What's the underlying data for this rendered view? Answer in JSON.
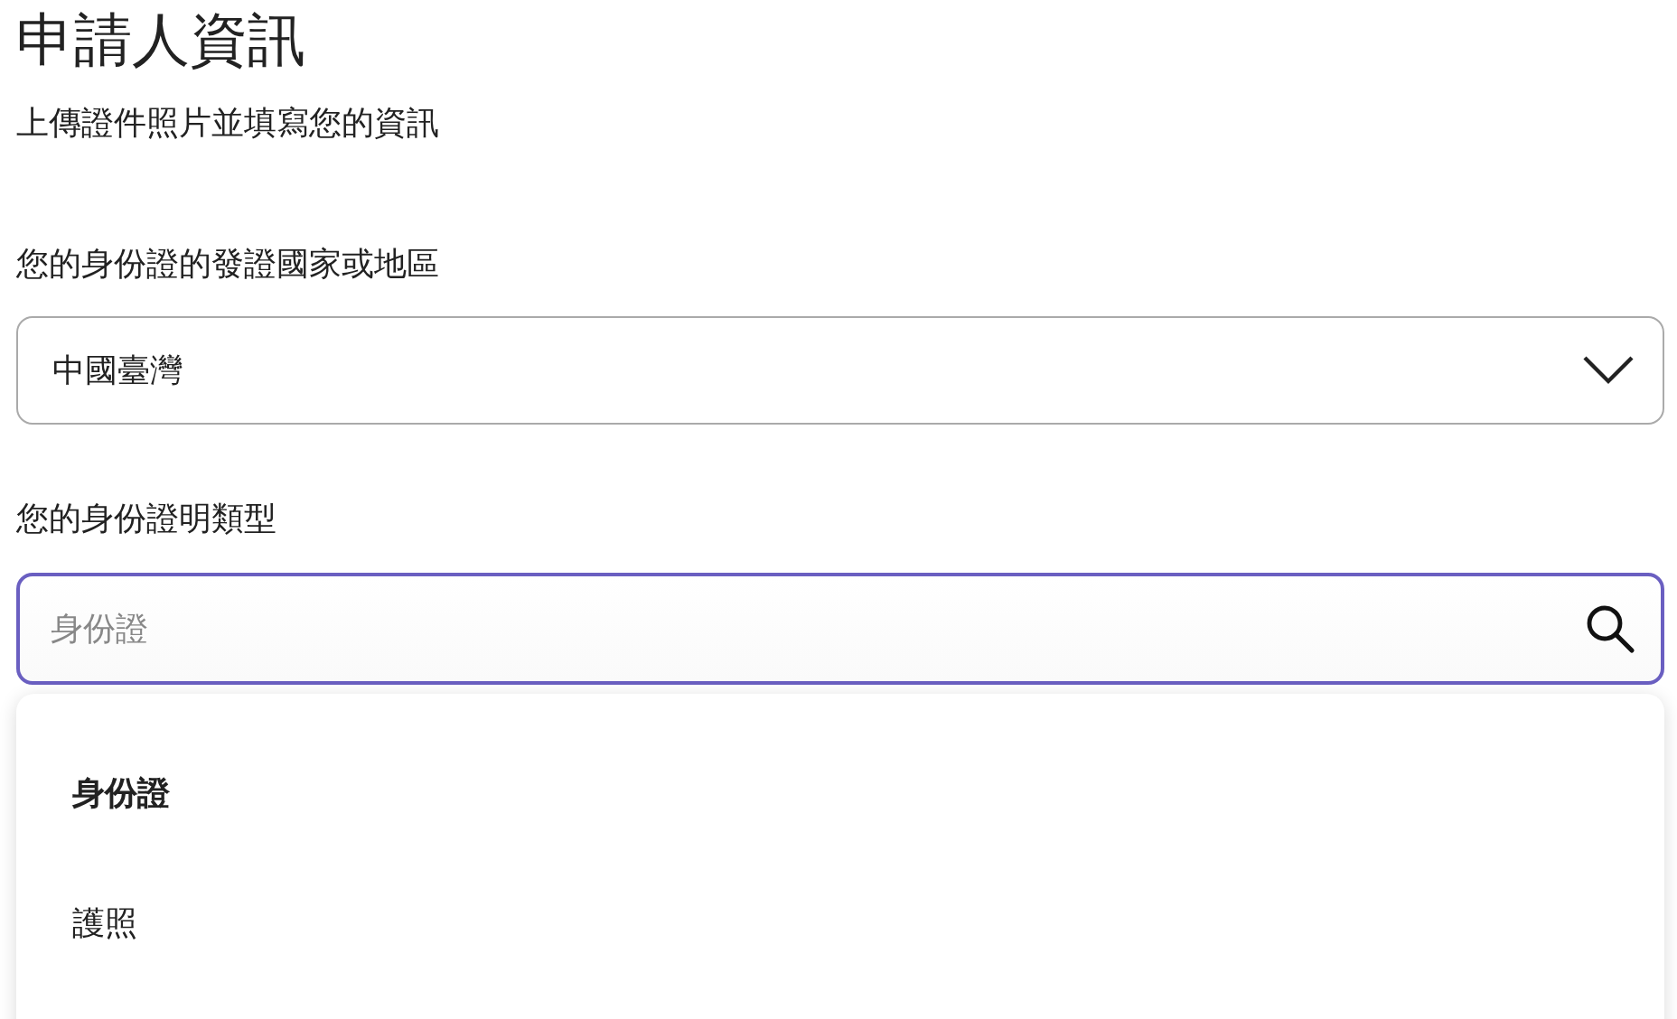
{
  "title": "申請人資訊",
  "subtitle": "上傳證件照片並填寫您的資訊",
  "country_field": {
    "label": "您的身份證的發證國家或地區",
    "value": "中國臺灣"
  },
  "id_type_field": {
    "label": "您的身份證明類型",
    "placeholder": "身份證",
    "focused": true
  },
  "dropdown": {
    "options": [
      {
        "label": "身份證",
        "selected": true
      },
      {
        "label": "護照",
        "selected": false
      }
    ]
  }
}
